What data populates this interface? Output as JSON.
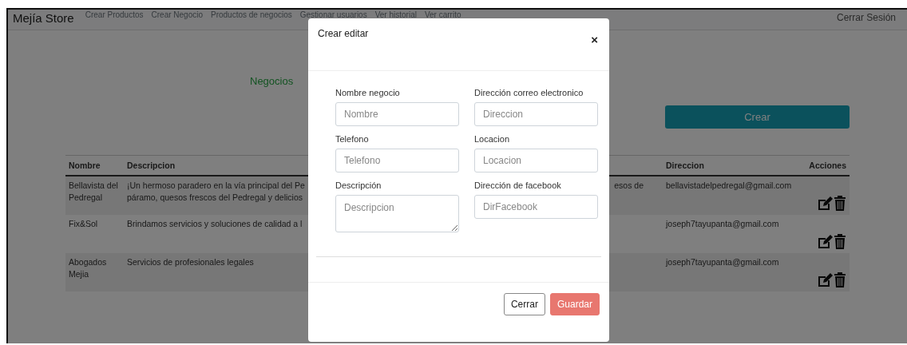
{
  "navbar": {
    "brand": "Mejía Store",
    "links": [
      {
        "label": "Crear Productos"
      },
      {
        "label": "Crear Negocio"
      },
      {
        "label": "Productos de negocios"
      },
      {
        "label": "Gestionar usuarios"
      },
      {
        "label": "Ver historial"
      },
      {
        "label": "Ver carrito"
      }
    ],
    "logout": "Cerrar Sesión"
  },
  "page": {
    "heading": "Negocios",
    "create_button": "Crear"
  },
  "table": {
    "columns": [
      {
        "label": "Nombre"
      },
      {
        "label": "Descripcion"
      },
      {
        "label": "Direccion"
      },
      {
        "label": "Acciones"
      }
    ],
    "rows": [
      {
        "nombre": "Bellavista del Pedregal",
        "descripcion": "¡Un hermoso paradero en la vía principal del Pe\npáramo, quesos frescos del Pedregal y delicios",
        "column_3": "esos de",
        "direccion": "bellavistadelpedregal@gmail.com"
      },
      {
        "nombre": "Fix&Sol",
        "descripcion": "Brindamos servicios y soluciones de calidad a l",
        "direccion": "joseph7tayupanta@gmail.com"
      },
      {
        "nombre": "Abogados Mejia",
        "descripcion": "Servicios de profesionales legales",
        "direccion": "joseph7tayupanta@gmail.com"
      }
    ]
  },
  "modal": {
    "title": "Crear editar",
    "close": "×",
    "fields": [
      {
        "label": "Nombre negocio",
        "placeholder": "Nombre",
        "kind": "input"
      },
      {
        "label": "Dirección correo electronico",
        "placeholder": "Direccion",
        "kind": "input"
      },
      {
        "label": "Telefono",
        "placeholder": "Telefono",
        "kind": "input"
      },
      {
        "label": "Locacion",
        "placeholder": "Locacion",
        "kind": "input"
      },
      {
        "label": "Descripción",
        "placeholder": "Descripcion",
        "kind": "textarea"
      },
      {
        "label": "Dirección de facebook",
        "placeholder": "DirFacebook",
        "kind": "input"
      }
    ],
    "buttons": [
      {
        "label": "Cerrar",
        "kind": "secondary"
      },
      {
        "label": "Guardar",
        "kind": "primary"
      }
    ]
  }
}
